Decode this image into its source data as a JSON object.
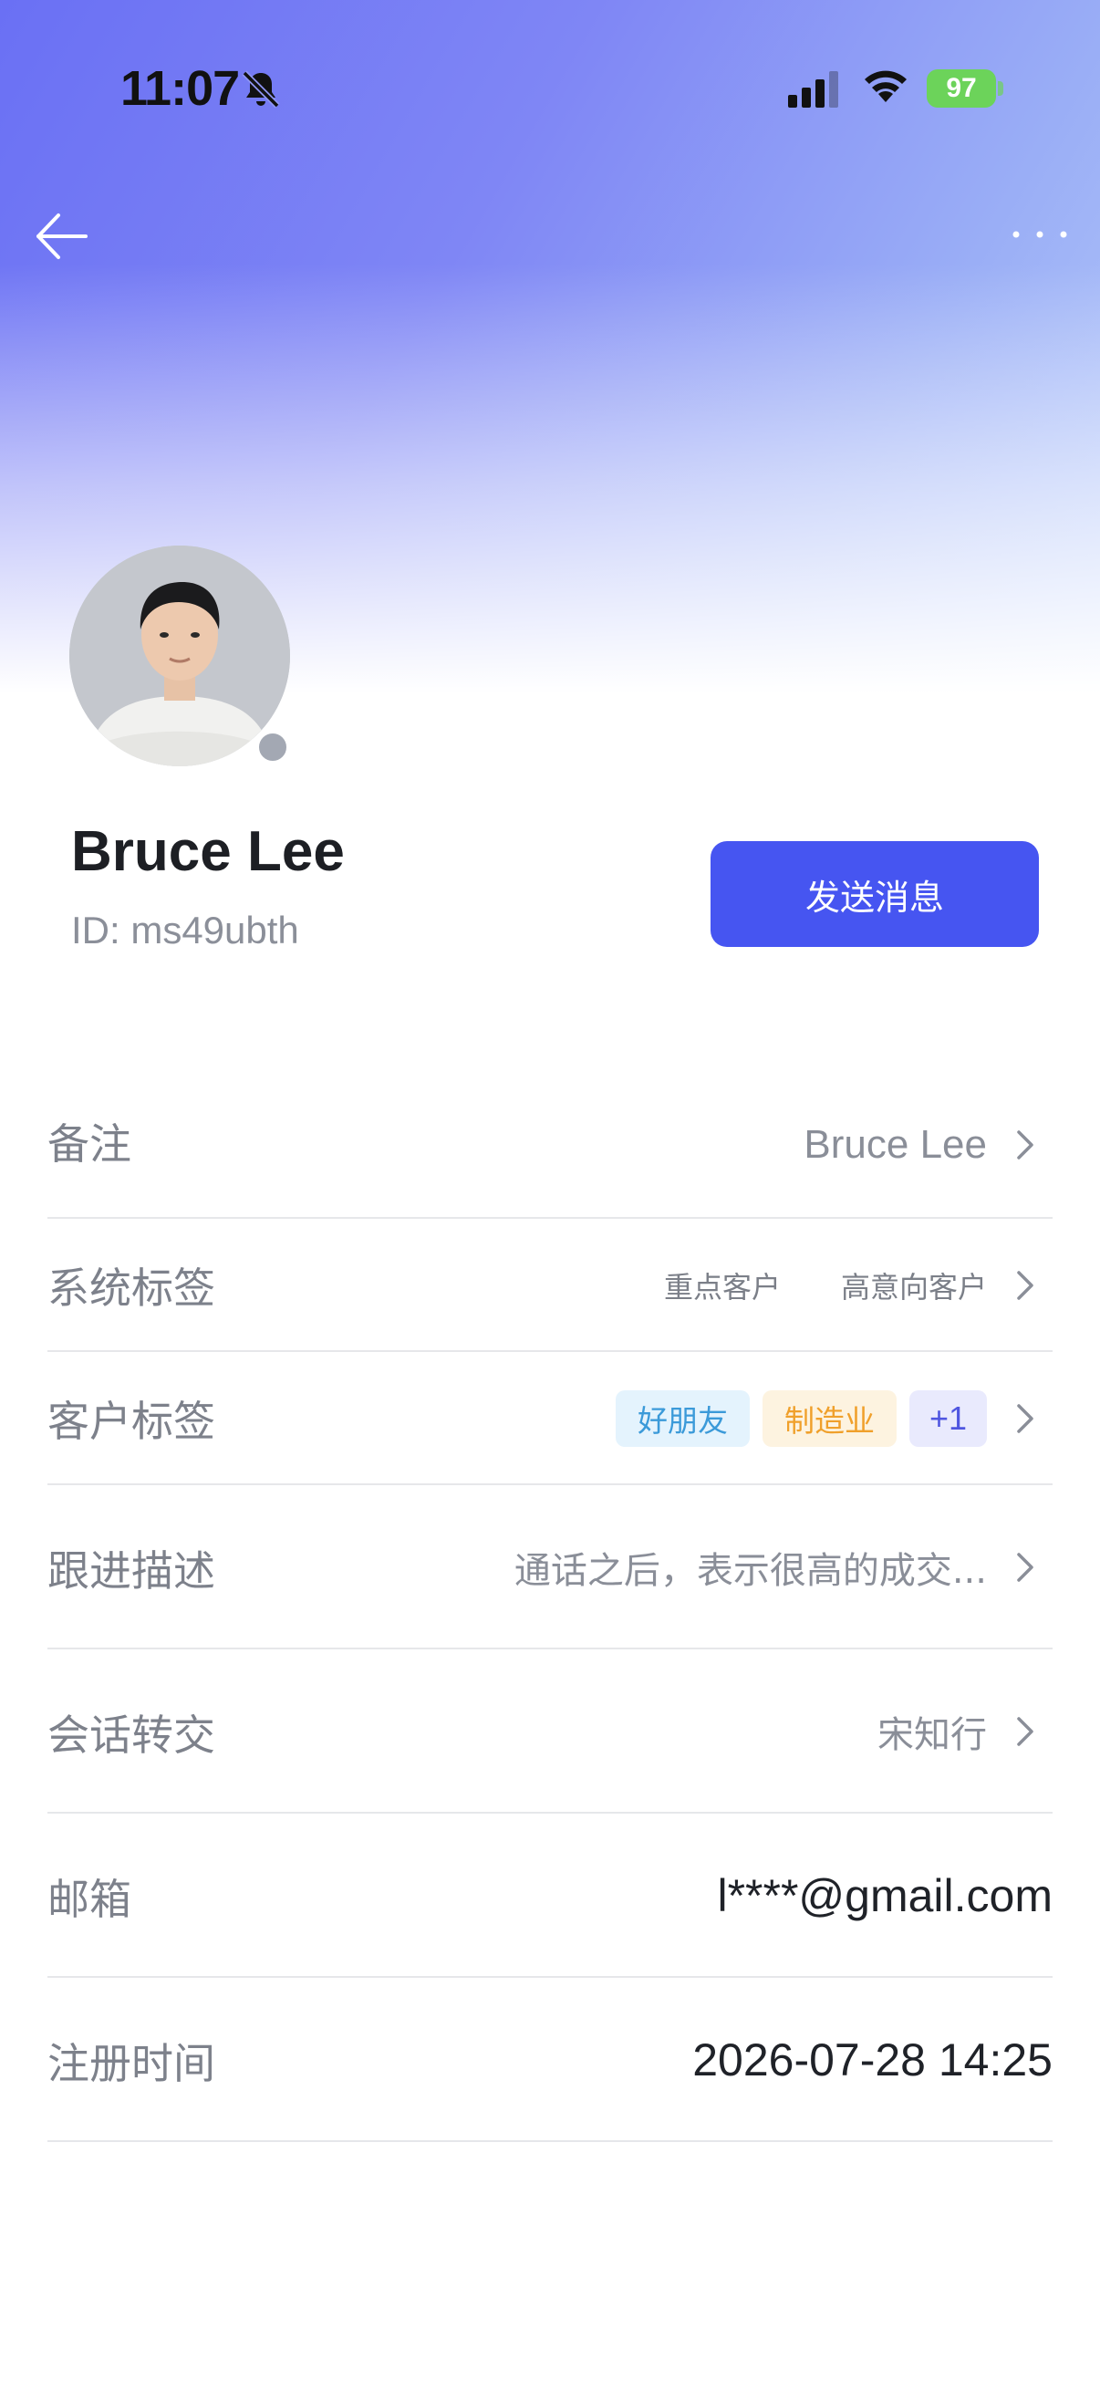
{
  "status_bar": {
    "time": "11:07",
    "battery": "97"
  },
  "profile": {
    "name": "Bruce Lee",
    "id": "ID: ms49ubth",
    "send_message_label": "发送消息"
  },
  "rows": {
    "remark": {
      "label": "备注",
      "value": "Bruce Lee"
    },
    "system_tags": {
      "label": "系统标签",
      "tags": [
        "重点客户",
        "高意向客户"
      ]
    },
    "customer_tags": {
      "label": "客户标签",
      "tags": [
        "好朋友",
        "制造业"
      ],
      "more": "+1"
    },
    "follow_up": {
      "label": "跟进描述",
      "value": "通话之后，表示很高的成交..."
    },
    "transfer": {
      "label": "会话转交",
      "value": "宋知行"
    },
    "email": {
      "label": "邮箱",
      "value": "l****@gmail.com"
    },
    "register_time": {
      "label": "注册时间",
      "value": "2026-07-28 14:25"
    }
  },
  "icons": {
    "back": "arrow-left-icon",
    "more": "more-dots-icon",
    "chevron": "chevron-right-icon",
    "bell": "bell-off-icon",
    "signal": "signal-icon",
    "wifi": "wifi-icon"
  },
  "colors": {
    "accent": "#4655f1",
    "online_dot": "#a3a8b3",
    "tag_blue": "#3b9ad9",
    "tag_orange": "#f0a02b",
    "tag_purple": "#4f56e0"
  }
}
